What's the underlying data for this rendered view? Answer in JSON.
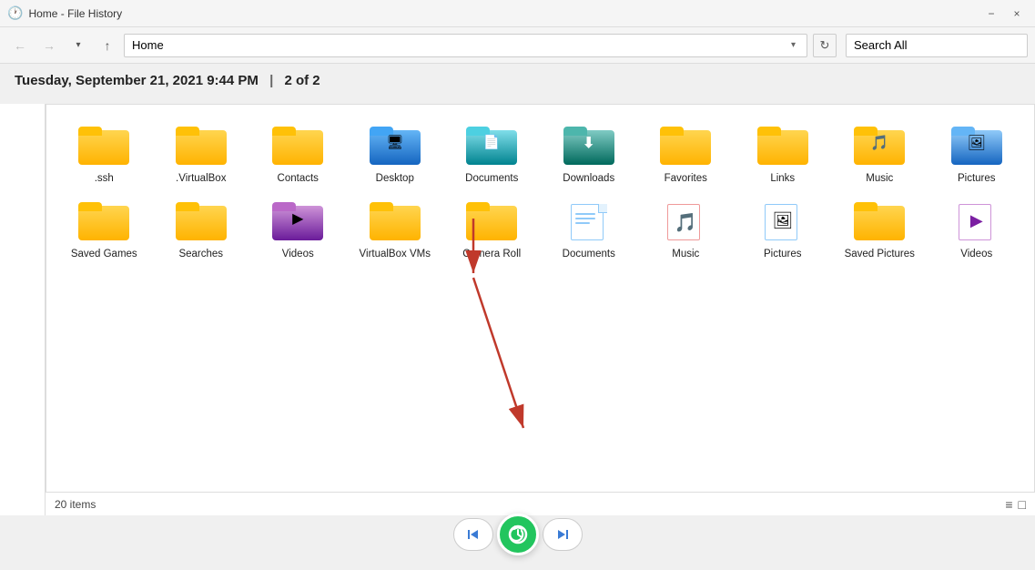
{
  "titleBar": {
    "title": "Home - File History",
    "minimizeLabel": "−",
    "closeLabel": "×"
  },
  "navBar": {
    "backLabel": "←",
    "forwardLabel": "→",
    "upLabel": "↑",
    "addressValue": "Home",
    "refreshLabel": "↻",
    "searchPlaceholder": "Search All",
    "searchValue": "Search All"
  },
  "dateHeader": {
    "text": "Tuesday, September 21, 2021 9:44 PM",
    "separator": "|",
    "pageInfo": "2 of 2"
  },
  "statusBar": {
    "itemCount": "20 items",
    "viewIconLabel1": "≡",
    "viewIconLabel2": "□"
  },
  "bottomNav": {
    "prevLabel": "◀◀",
    "nextLabel": "▶▶",
    "restoreLabel": "↺"
  },
  "files": [
    {
      "id": "ssh",
      "label": ".ssh",
      "type": "folder-basic"
    },
    {
      "id": "virtualbox",
      "label": ".VirtualBox",
      "type": "folder-basic"
    },
    {
      "id": "contacts",
      "label": "Contacts",
      "type": "folder-basic"
    },
    {
      "id": "desktop",
      "label": "Desktop",
      "type": "folder-desktop"
    },
    {
      "id": "documents",
      "label": "Documents",
      "type": "folder-docs-blue"
    },
    {
      "id": "downloads",
      "label": "Downloads",
      "type": "folder-downloads"
    },
    {
      "id": "favorites",
      "label": "Favorites",
      "type": "folder-basic"
    },
    {
      "id": "links",
      "label": "Links",
      "type": "folder-basic"
    },
    {
      "id": "music",
      "label": "Music",
      "type": "folder-music-icon"
    },
    {
      "id": "pictures",
      "label": "Pictures",
      "type": "folder-pictures-icon"
    },
    {
      "id": "saved-games",
      "label": "Saved Games",
      "type": "folder-basic"
    },
    {
      "id": "searches",
      "label": "Searches",
      "type": "folder-basic"
    },
    {
      "id": "videos",
      "label": "Videos",
      "type": "folder-videos-purple"
    },
    {
      "id": "virtualbox-vms",
      "label": "VirtualBox VMs",
      "type": "folder-basic"
    },
    {
      "id": "camera-roll",
      "label": "Camera Roll",
      "type": "folder-basic-yellow"
    },
    {
      "id": "documents2",
      "label": "Documents",
      "type": "file-doc-blue"
    },
    {
      "id": "music2",
      "label": "Music",
      "type": "file-music"
    },
    {
      "id": "pictures2",
      "label": "Pictures",
      "type": "file-pictures"
    },
    {
      "id": "saved-pictures",
      "label": "Saved Pictures",
      "type": "folder-basic"
    },
    {
      "id": "videos2",
      "label": "Videos",
      "type": "file-videos"
    }
  ]
}
